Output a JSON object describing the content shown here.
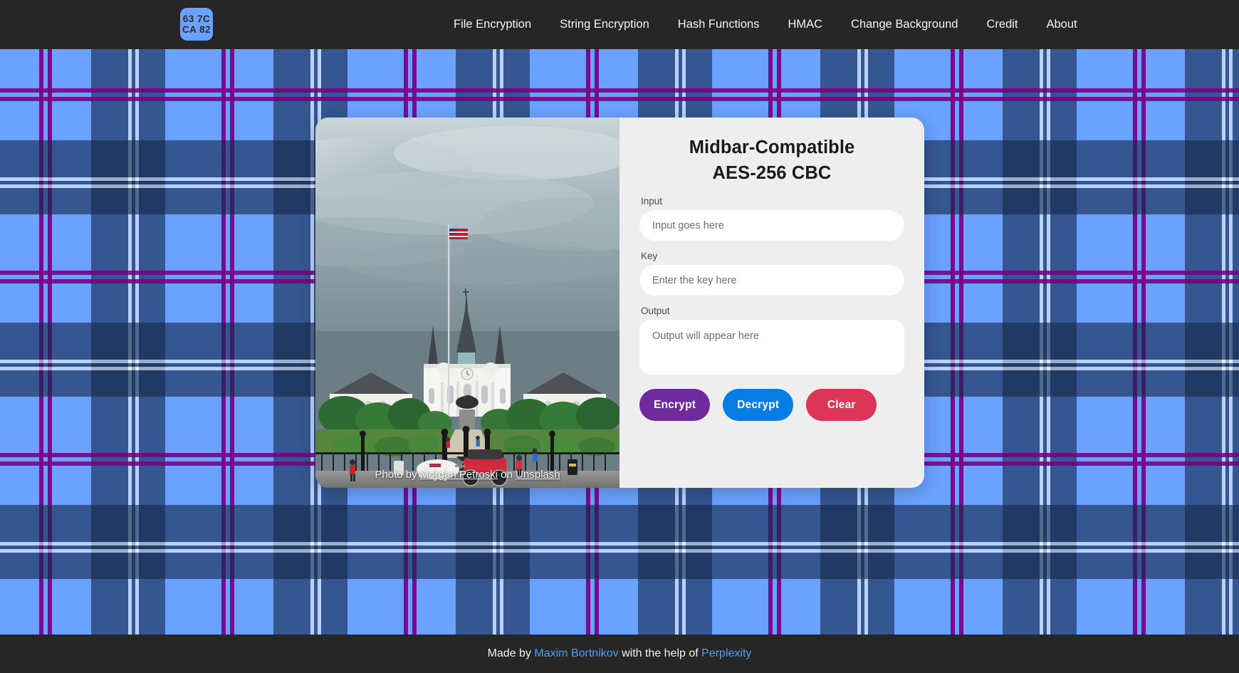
{
  "navbar": {
    "logo": {
      "name": "aes-sbox-logo",
      "line1": "63 7C",
      "line2": "CA 82",
      "color": "#6ba1ff"
    },
    "links": [
      {
        "label": "File Encryption",
        "name": "nav-link-file-encryption"
      },
      {
        "label": "String Encryption",
        "name": "nav-link-string-encryption"
      },
      {
        "label": "Hash Functions",
        "name": "nav-link-hash-functions"
      },
      {
        "label": "HMAC",
        "name": "nav-link-hmac"
      },
      {
        "label": "Change Background",
        "name": "nav-link-change-background"
      },
      {
        "label": "Credit",
        "name": "nav-link-credit"
      },
      {
        "label": "About",
        "name": "nav-link-about"
      }
    ],
    "background_color": "#262626"
  },
  "background": {
    "pattern": "tartan-plaid",
    "colors": {
      "light_blue": "#6ba1ff",
      "medium_blue": "#2d5383",
      "dark_navy": "#1a2943",
      "purple": "#780082",
      "white_stripe": "#ffffff"
    },
    "tile_size_px": 256
  },
  "card": {
    "title_line1": "Midbar-Compatible",
    "title_line2": "AES-256 CBC",
    "photo": {
      "alt": "St. Louis Cathedral at Jackson Square, New Orleans, under a cloudy sky with a horse-drawn carriage in the foreground",
      "credit_prefix": "Photo by ",
      "credit_author": "Morgan Petroski",
      "credit_middle": " on ",
      "credit_source": "Unsplash"
    },
    "fields": [
      {
        "label": "Input",
        "placeholder": "Input goes here",
        "value": "",
        "name": "input-field"
      },
      {
        "label": "Key",
        "placeholder": "Enter the key here",
        "value": "",
        "name": "key-field"
      },
      {
        "label": "Output",
        "placeholder": "Output will appear here",
        "value": "",
        "name": "output-field"
      }
    ],
    "buttons": [
      {
        "label": "Encrypt",
        "color": "#6f2a9e",
        "name": "encrypt-button"
      },
      {
        "label": "Decrypt",
        "color": "#067de4",
        "name": "decrypt-button"
      },
      {
        "label": "Clear",
        "color": "#dd3557",
        "name": "clear-button"
      }
    ],
    "background_color": "#eeeeee"
  },
  "footer": {
    "prefix": "Made by ",
    "author": "Maxim Bortnikov",
    "middle": " with the help of ",
    "helper": "Perplexity",
    "link_color": "#4da2f0",
    "background_color": "#262626"
  }
}
